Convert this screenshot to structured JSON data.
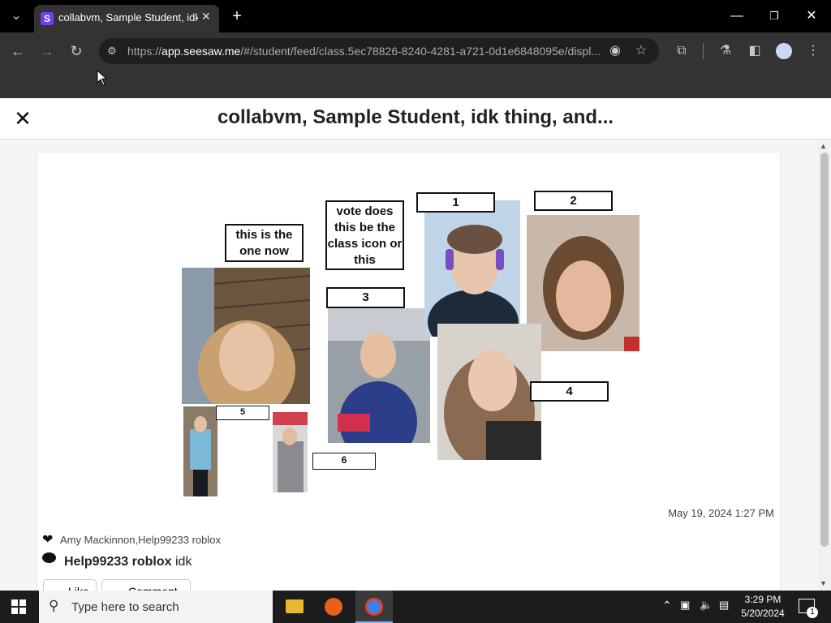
{
  "browser": {
    "tab_title": "collabvm, Sample Student, idk thing, and...",
    "favicon_letter": "S",
    "url_prefix": "https://",
    "url_host": "app.seesaw.me",
    "url_path": "/#/student/feed/class.5ec78826-8240-4281-a721-0d1e6848095e/displ..."
  },
  "page": {
    "title": "collabvm, Sample Student, idk thing, and..."
  },
  "post": {
    "labels": {
      "this_one": "this is the one now",
      "vote": "vote does this be the class icon or this",
      "n1": "1",
      "n2": "2",
      "n3": "3",
      "n4": "4",
      "n5": "5",
      "n6": "6"
    },
    "timestamp": "May 19, 2024 1:27 PM",
    "likes": "Amy Mackinnon,Help99233 roblox",
    "comment_author": "Help99233 roblox",
    "comment_text": "idk",
    "like_label": "Like",
    "comment_label": "Comment"
  },
  "taskbar": {
    "search_placeholder": "Type here to search",
    "time": "3:29 PM",
    "date": "5/20/2024",
    "notification_count": "1"
  },
  "colors": {
    "accent": "#6f3ff5",
    "chrome_dark": "#333333"
  }
}
